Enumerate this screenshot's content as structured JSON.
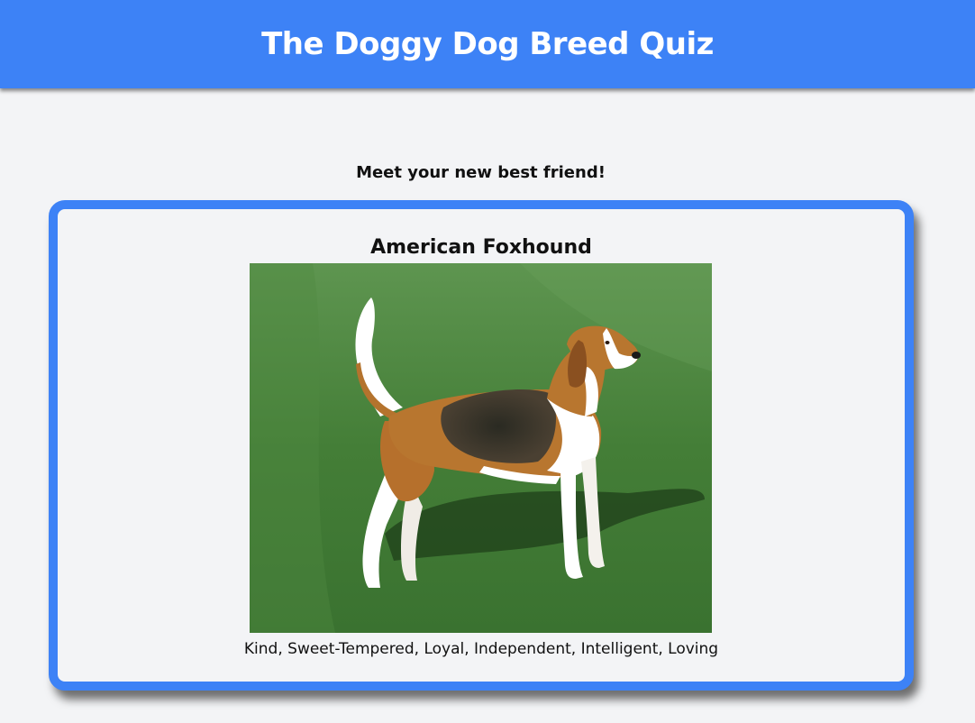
{
  "header": {
    "title": "The Doggy Dog Breed Quiz",
    "color": "#3d82f6"
  },
  "result": {
    "subtitle": "Meet your new best friend!",
    "breed": "American Foxhound",
    "traits": "Kind, Sweet-Tempered, Loyal, Independent, Intelligent, Loving",
    "image_subject": "american-foxhound-photo"
  }
}
